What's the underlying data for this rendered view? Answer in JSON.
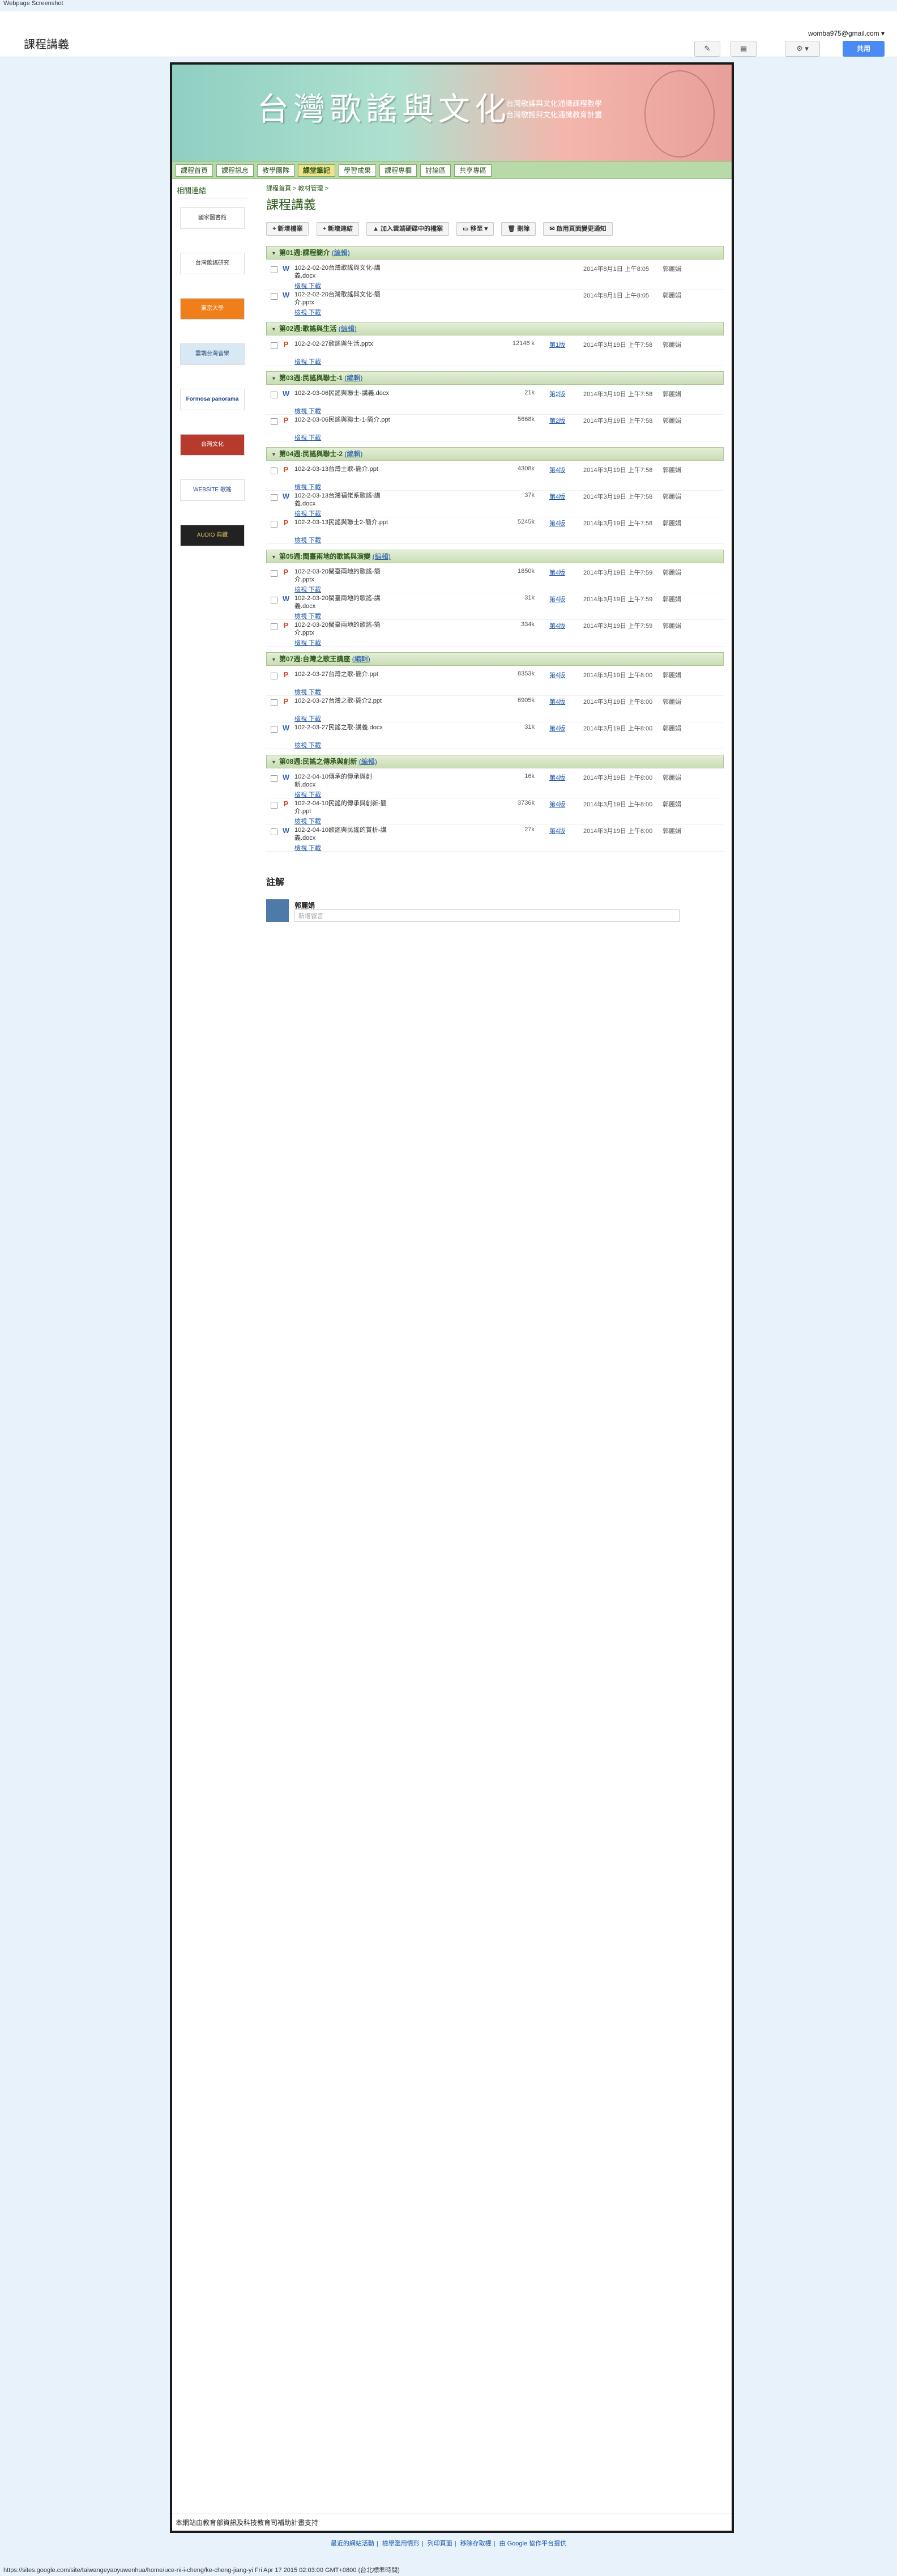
{
  "capture_label": "Webpage Screenshot",
  "site": {
    "name": "課程講義",
    "account": "womba975@gmail.com ▾",
    "share": "共用"
  },
  "banner": {
    "title": "台灣歌謠與文化",
    "sub1": "台灣歌謠與文化通識課程教學",
    "sub2": "台灣歌謠與文化通識教育計畫"
  },
  "nav": [
    "課程首頁",
    "課程訊息",
    "教學團隊",
    "課堂筆記",
    "學習成果",
    "課程專欄",
    "討論區",
    "共享專區"
  ],
  "sidebar": {
    "heading": "相關連結",
    "logos": [
      "國家圖書館",
      "台灣歌謠研究",
      "東京大學",
      "雲端台灣音樂",
      "Formosa panorama",
      "台灣文化",
      "WEBSITE 歌謠",
      "AUDIO 典藏"
    ]
  },
  "breadcrumb": "課程首頁 > 教材管理 >",
  "page_title": "課程講義",
  "toolbar": [
    "新增檔案",
    "新增連結",
    "加入雲端硬碟中的檔案",
    "移至 ▾",
    "刪除",
    "啟用頁面變更通知"
  ],
  "file_links": "檢視 下載",
  "sections": [
    {
      "title": "第01週:課程簡介",
      "edit": "(編輯)",
      "files": [
        {
          "type": "w",
          "name": "102-2-02-20台灣歌謠與文化-講義.docx",
          "size": "",
          "ver": "",
          "date": "2014年8月1日 上午8:05",
          "user": "郭麗娟"
        },
        {
          "type": "w",
          "name": "102-2-02-20台灣歌謠與文化-簡介.pptx",
          "size": "",
          "ver": "",
          "date": "2014年8月1日 上午8:05",
          "user": "郭麗娟"
        }
      ]
    },
    {
      "title": "第02週:歌謠與生活",
      "edit": "(編輯)",
      "files": [
        {
          "type": "p",
          "name": "102-2-02-27歌謠與生活.pptx",
          "size": "12146 k",
          "ver": "第1版",
          "date": "2014年3月19日 上午7:58",
          "user": "郭麗娟"
        }
      ]
    },
    {
      "title": "第03週:民謠與聯士-1",
      "edit": "(編輯)",
      "files": [
        {
          "type": "w",
          "name": "102-2-03-06民謠與聯士-講義.docx",
          "size": "21k",
          "ver": "第2版",
          "date": "2014年3月19日 上午7:58",
          "user": "郭麗娟"
        },
        {
          "type": "p",
          "name": "102-2-03-06民謠與聯士-1-簡介.ppt",
          "size": "5668k",
          "ver": "第2版",
          "date": "2014年3月19日 上午7:58",
          "user": "郭麗娟"
        }
      ]
    },
    {
      "title": "第04週:民謠與聯士-2",
      "edit": "(編輯)",
      "files": [
        {
          "type": "p",
          "name": "102-2-03-13台灣土歌-簡介.ppt",
          "size": "4308k",
          "ver": "第4版",
          "date": "2014年3月19日 上午7:58",
          "user": "郭麗娟"
        },
        {
          "type": "w",
          "name": "102-2-03-13台灣福佬系歌謠-講義.docx",
          "size": "37k",
          "ver": "第4版",
          "date": "2014年3月19日 上午7:58",
          "user": "郭麗娟"
        },
        {
          "type": "p",
          "name": "102-2-03-13民謠與聯士2-簡介.ppt",
          "size": "5245k",
          "ver": "第4版",
          "date": "2014年3月19日 上午7:58",
          "user": "郭麗娟"
        }
      ]
    },
    {
      "title": "第05週:閩臺兩地的歌謠與演變",
      "edit": "(編輯)",
      "files": [
        {
          "type": "p",
          "name": "102-2-03-20閩臺兩地的歌謠-簡介.pptx",
          "size": "1850k",
          "ver": "第4版",
          "date": "2014年3月19日 上午7:59",
          "user": "郭麗娟"
        },
        {
          "type": "w",
          "name": "102-2-03-20閩臺兩地的歌謠-講義.docx",
          "size": "31k",
          "ver": "第4版",
          "date": "2014年3月19日 上午7:59",
          "user": "郭麗娟"
        },
        {
          "type": "p",
          "name": "102-2-03-20閩臺兩地的歌謠-簡介.pptx",
          "size": "334k",
          "ver": "第4版",
          "date": "2014年3月19日 上午7:59",
          "user": "郭麗娟"
        }
      ]
    },
    {
      "title": "第07週:台灣之歌王講座",
      "edit": "(編輯)",
      "files": [
        {
          "type": "p",
          "name": "102-2-03-27台灣之歌-簡介.ppt",
          "size": "8353k",
          "ver": "第4版",
          "date": "2014年3月19日 上午8:00",
          "user": "郭麗娟"
        },
        {
          "type": "p",
          "name": "102-2-03-27台灣之歌-簡介2.ppt",
          "size": "6905k",
          "ver": "第4版",
          "date": "2014年3月19日 上午8:00",
          "user": "郭麗娟"
        },
        {
          "type": "w",
          "name": "102-2-03-27民謠之歌-講義.docx",
          "size": "31k",
          "ver": "第4版",
          "date": "2014年3月19日 上午8:00",
          "user": "郭麗娟"
        }
      ]
    },
    {
      "title": "第08週:民謠之傳承與創新",
      "edit": "(編輯)",
      "files": [
        {
          "type": "w",
          "name": "102-2-04-10傳承的傳承與創新.docx",
          "size": "16k",
          "ver": "第4版",
          "date": "2014年3月19日 上午8:00",
          "user": "郭麗娟"
        },
        {
          "type": "p",
          "name": "102-2-04-10民謠的傳承與創新-簡介.ppt",
          "size": "3736k",
          "ver": "第4版",
          "date": "2014年3月19日 上午8:00",
          "user": "郭麗娟"
        },
        {
          "type": "w",
          "name": "102-2-04-10歌謠與民謠的賞析-講義.docx",
          "size": "27k",
          "ver": "第4版",
          "date": "2014年3月19日 上午8:00",
          "user": "郭麗娟"
        }
      ]
    }
  ],
  "comments": {
    "title": "註解",
    "name": "郭麗娟",
    "placeholder": "新增留言"
  },
  "footer": "本網站由教育部資訊及科技教育司補助計畫支持",
  "footer_links": [
    "最近的網站活動",
    "檢舉濫用情形",
    "列印頁面",
    "移除存取權",
    "由 Google 協作平台提供"
  ],
  "status_url": "https://sites.google.com/site/taiwangeyaoyuwenhua/home/uce-ni-i-cheng/ke-cheng-jiang-yi Fri Apr 17 2015 02:03:00 GMT+0800 (台北標準時間)"
}
